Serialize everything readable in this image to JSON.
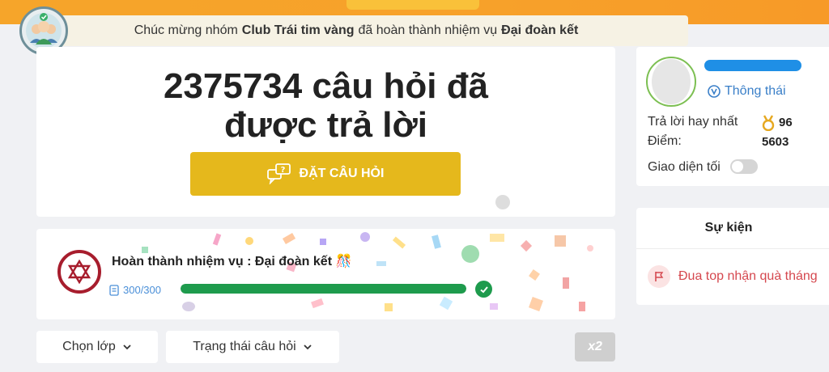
{
  "notice": {
    "prefix": "Chúc mừng nhóm",
    "club": "Club Trái tim vàng",
    "middle": "đã hoàn thành nhiệm vụ",
    "mission": "Đại đoàn kết"
  },
  "hero": {
    "title_line1": "2375734 câu hỏi đã",
    "title_line2": "được trả lời",
    "ask_label": "ĐẶT CÂU HỎI"
  },
  "mission": {
    "title": "Hoàn thành nhiệm vụ : Đại đoàn kết 🎊",
    "count": "300/300",
    "progress": 1.0
  },
  "filters": {
    "grade": "Chọn lớp",
    "status": "Trạng thái câu hỏi",
    "x2": "x2"
  },
  "profile": {
    "rank": "Thông thái",
    "best_answers_label": "Trả lời hay nhất",
    "best_answers_value": "96",
    "points_label": "Điểm:",
    "points_value": "5603",
    "dark_mode_label": "Giao diện tối",
    "dark_mode_on": false
  },
  "events": {
    "title": "Sự kiện",
    "item": "Đua top nhận quà tháng"
  },
  "colors": {
    "accent": "#e5b81c",
    "progress": "#1e9b4d",
    "event": "#d5484f",
    "rank": "#3a7fc8"
  }
}
